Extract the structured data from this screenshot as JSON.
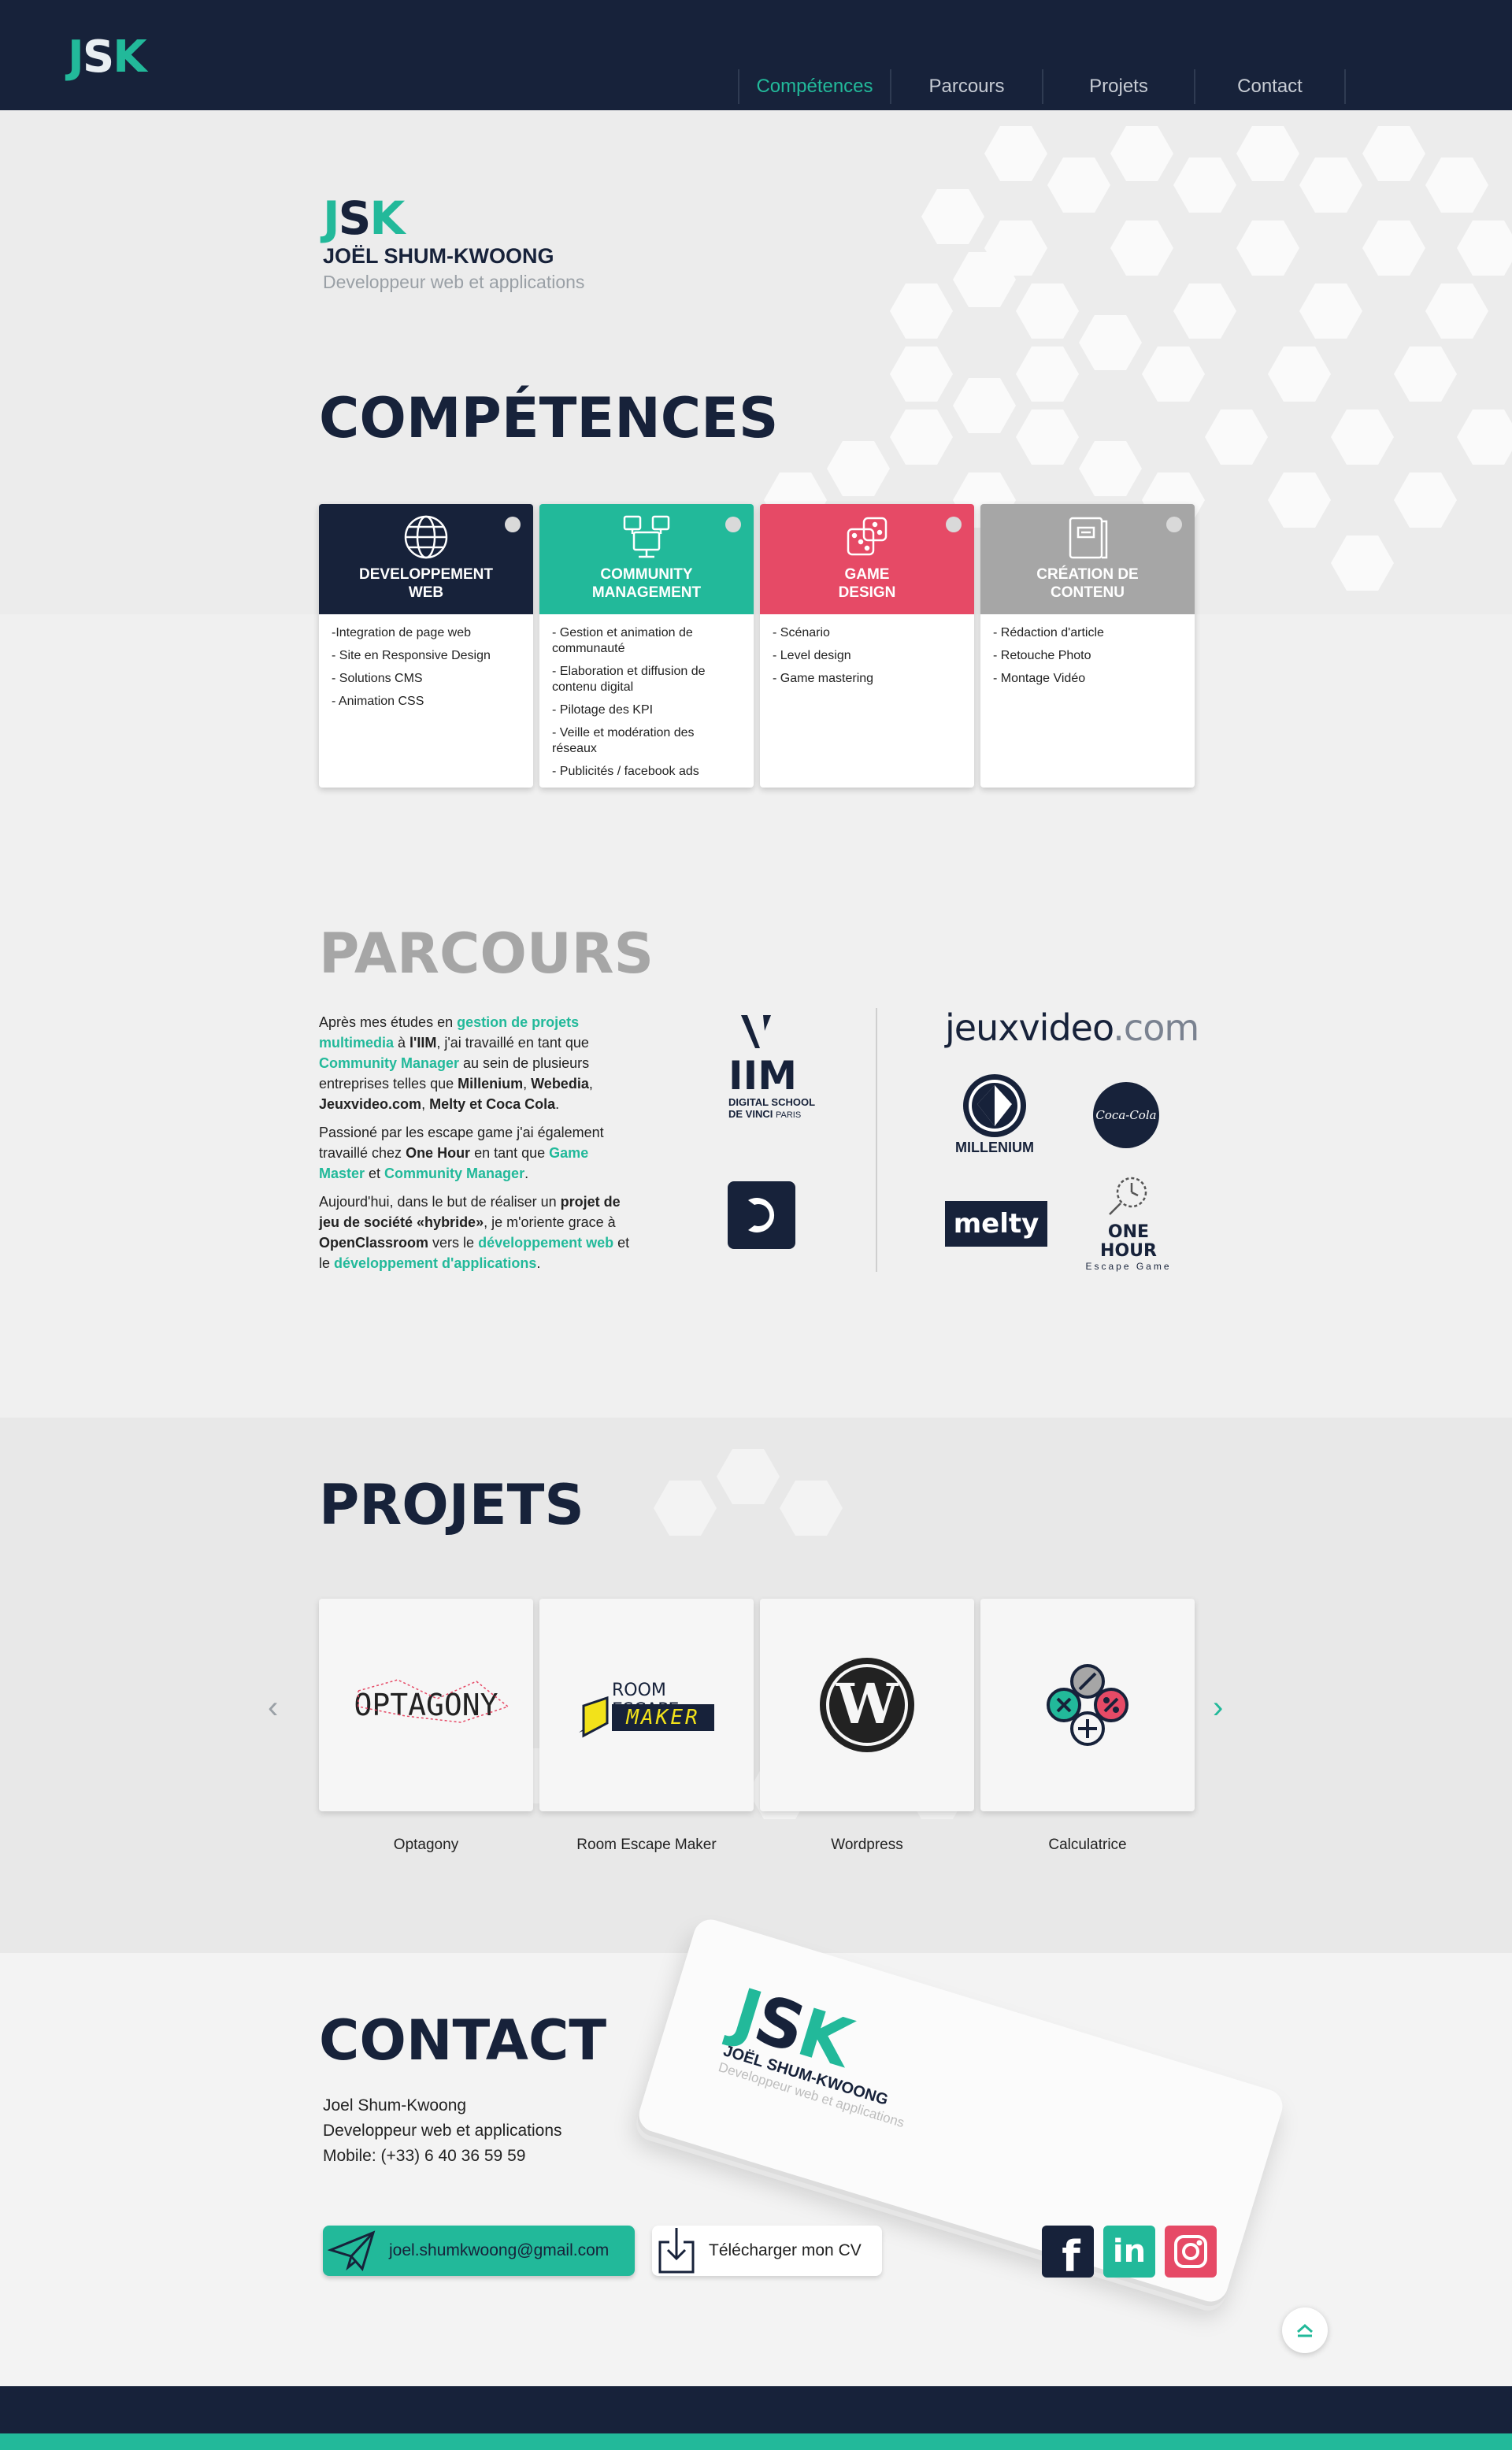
{
  "nav": {
    "logo": "JSK",
    "items": [
      "Compétences",
      "Parcours",
      "Projets",
      "Contact"
    ]
  },
  "hero": {
    "logo": "JSK",
    "name": "JOËL SHUM-KWOONG",
    "subtitle": "Developpeur web et applications"
  },
  "competences": {
    "title": "COMPÉTENCES",
    "cards": [
      {
        "title_l1": "DEVELOPPEMENT",
        "title_l2": "WEB",
        "color": "#17223a",
        "icon": "globe-icon",
        "items": [
          "-Integration de page web",
          "- Site en Responsive Design",
          "- Solutions CMS",
          "- Animation CSS"
        ]
      },
      {
        "title_l1": "COMMUNITY",
        "title_l2": "MANAGEMENT",
        "color": "#22b99a",
        "icon": "network-computers-icon",
        "items": [
          "- Gestion et animation de communauté",
          "- Elaboration et diffusion de contenu digital",
          "- Pilotage des KPI",
          "- Veille et modération des réseaux",
          "- Publicités / facebook ads"
        ]
      },
      {
        "title_l1": "GAME",
        "title_l2": "DESIGN",
        "color": "#e64a66",
        "icon": "dice-icon",
        "items": [
          "- Scénario",
          "- Level design",
          "- Game mastering"
        ]
      },
      {
        "title_l1": "CRÉATION DE",
        "title_l2": "CONTENU",
        "color": "#a6a6a6",
        "icon": "notebook-icon",
        "items": [
          "- Rédaction d'article",
          "- Retouche Photo",
          "- Montage Vidéo"
        ]
      }
    ]
  },
  "parcours": {
    "title": "PARCOURS",
    "p1": {
      "a": "Après mes études en ",
      "b": "gestion de projets multimedia",
      "c": " à ",
      "d": "l'IIM",
      "e": ", j'ai travaillé en tant que ",
      "f": "Community Manager",
      "g": " au sein de plusieurs entreprises telles que ",
      "h": "Millenium",
      "i": ", ",
      "j": "Webedia",
      "k": ", ",
      "l": "Jeuxvideo.com",
      "m": ", ",
      "n": "Melty et Coca Cola",
      "o": "."
    },
    "p2": {
      "a": "Passioné par les escape game j'ai également travaillé chez ",
      "b": "One Hour",
      "c": " en tant que ",
      "d": "Game Master",
      "e": " et ",
      "f": "Community Manager",
      "g": "."
    },
    "p3": {
      "a": "Aujourd'hui, dans le but de réaliser un ",
      "b": "projet de jeu de société «hybride»",
      "c": ", je m'oriente grace à ",
      "d": "OpenClassroom",
      "e": " vers le ",
      "f": "développement web",
      "g": " et le ",
      "h": "développement d'applications",
      "i": "."
    },
    "logos": {
      "iim_main": "IIM",
      "iim_sub1": "DIGITAL SCHOOL",
      "iim_sub2": "DE VINCI",
      "iim_sub3": "PARIS",
      "jvc_a": "jeuxvideo",
      "jvc_b": ".com",
      "millenium": "MILLENIUM",
      "coca": "Coca-Cola",
      "melty": "melty",
      "onehour": "ONE HOUR",
      "onehour_sub": "Escape Game"
    }
  },
  "projets": {
    "title": "PROJETS",
    "items": [
      "Optagony",
      "Room Escape Maker",
      "Wordpress",
      "Calculatrice"
    ],
    "optagony_logo": "OPTAGONY",
    "rem_logo_a": "ROOM ESCAPE",
    "rem_logo_b": "MAKER",
    "prev": "‹",
    "next": "›"
  },
  "contact": {
    "title": "CONTACT",
    "name": "Joel Shum-Kwoong",
    "role": "Developpeur web et applications",
    "phone": "Mobile: (+33) 6 40 36 59 59",
    "email": "joel.shumkwoong@gmail.com",
    "cv": "Télécharger mon CV",
    "card_logo": "JSK",
    "card_name": "JOËL SHUM-KWOONG",
    "card_sub": "Developpeur web et applications",
    "facebook": "f",
    "linkedin": "in"
  },
  "colors": {
    "navy": "#17223a",
    "teal": "#22b99a",
    "pink": "#e64a66",
    "gray": "#a6a6a6",
    "instagram": "#e64a66"
  }
}
